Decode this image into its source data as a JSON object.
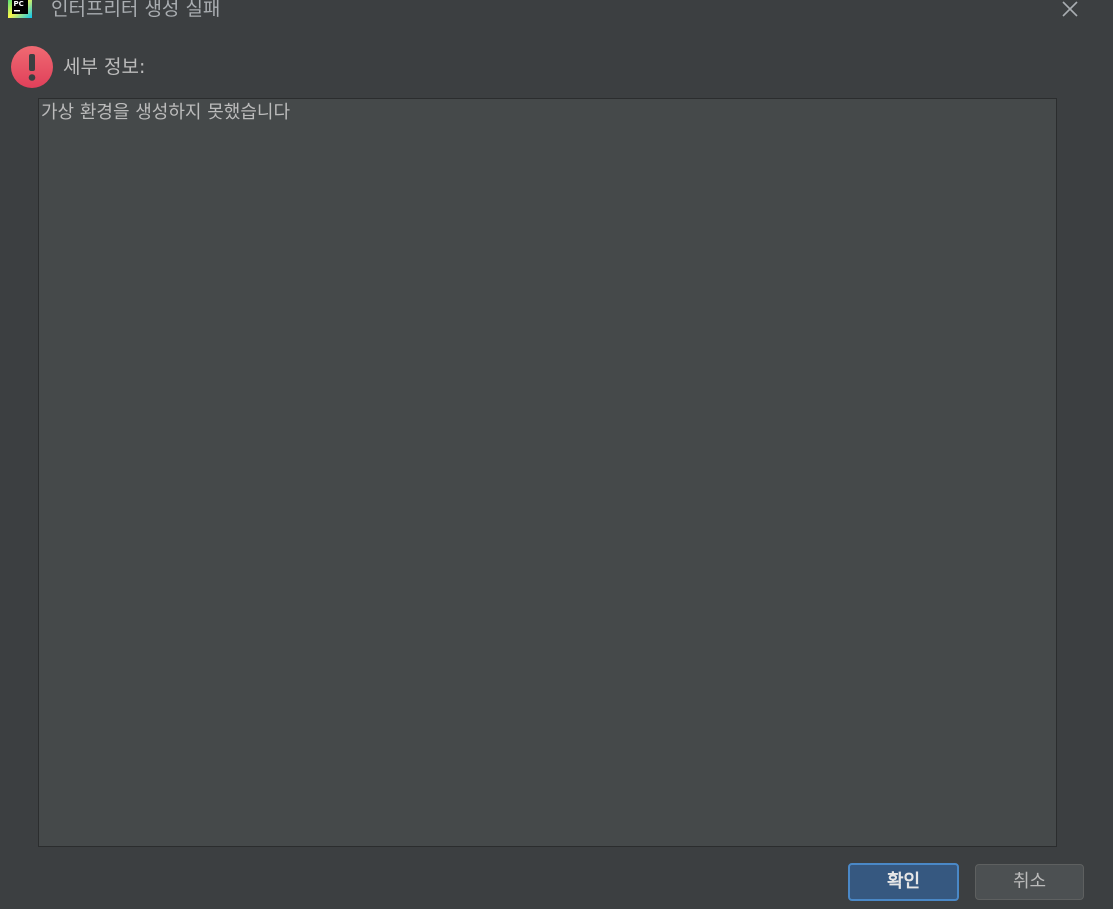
{
  "window": {
    "title": "인터프리터 생성 실패",
    "app_icon": "pycharm-icon"
  },
  "content": {
    "details_label": "세부 정보:",
    "details_text": "가상 환경을 생성하지 못했습니다",
    "status_icon": "error-icon"
  },
  "buttons": {
    "ok_label": "확인",
    "cancel_label": "취소"
  },
  "colors": {
    "background": "#3c3f41",
    "text_area": "#45494a",
    "primary_button": "#365880",
    "primary_border": "#4a88c7",
    "error": "#e85567"
  }
}
